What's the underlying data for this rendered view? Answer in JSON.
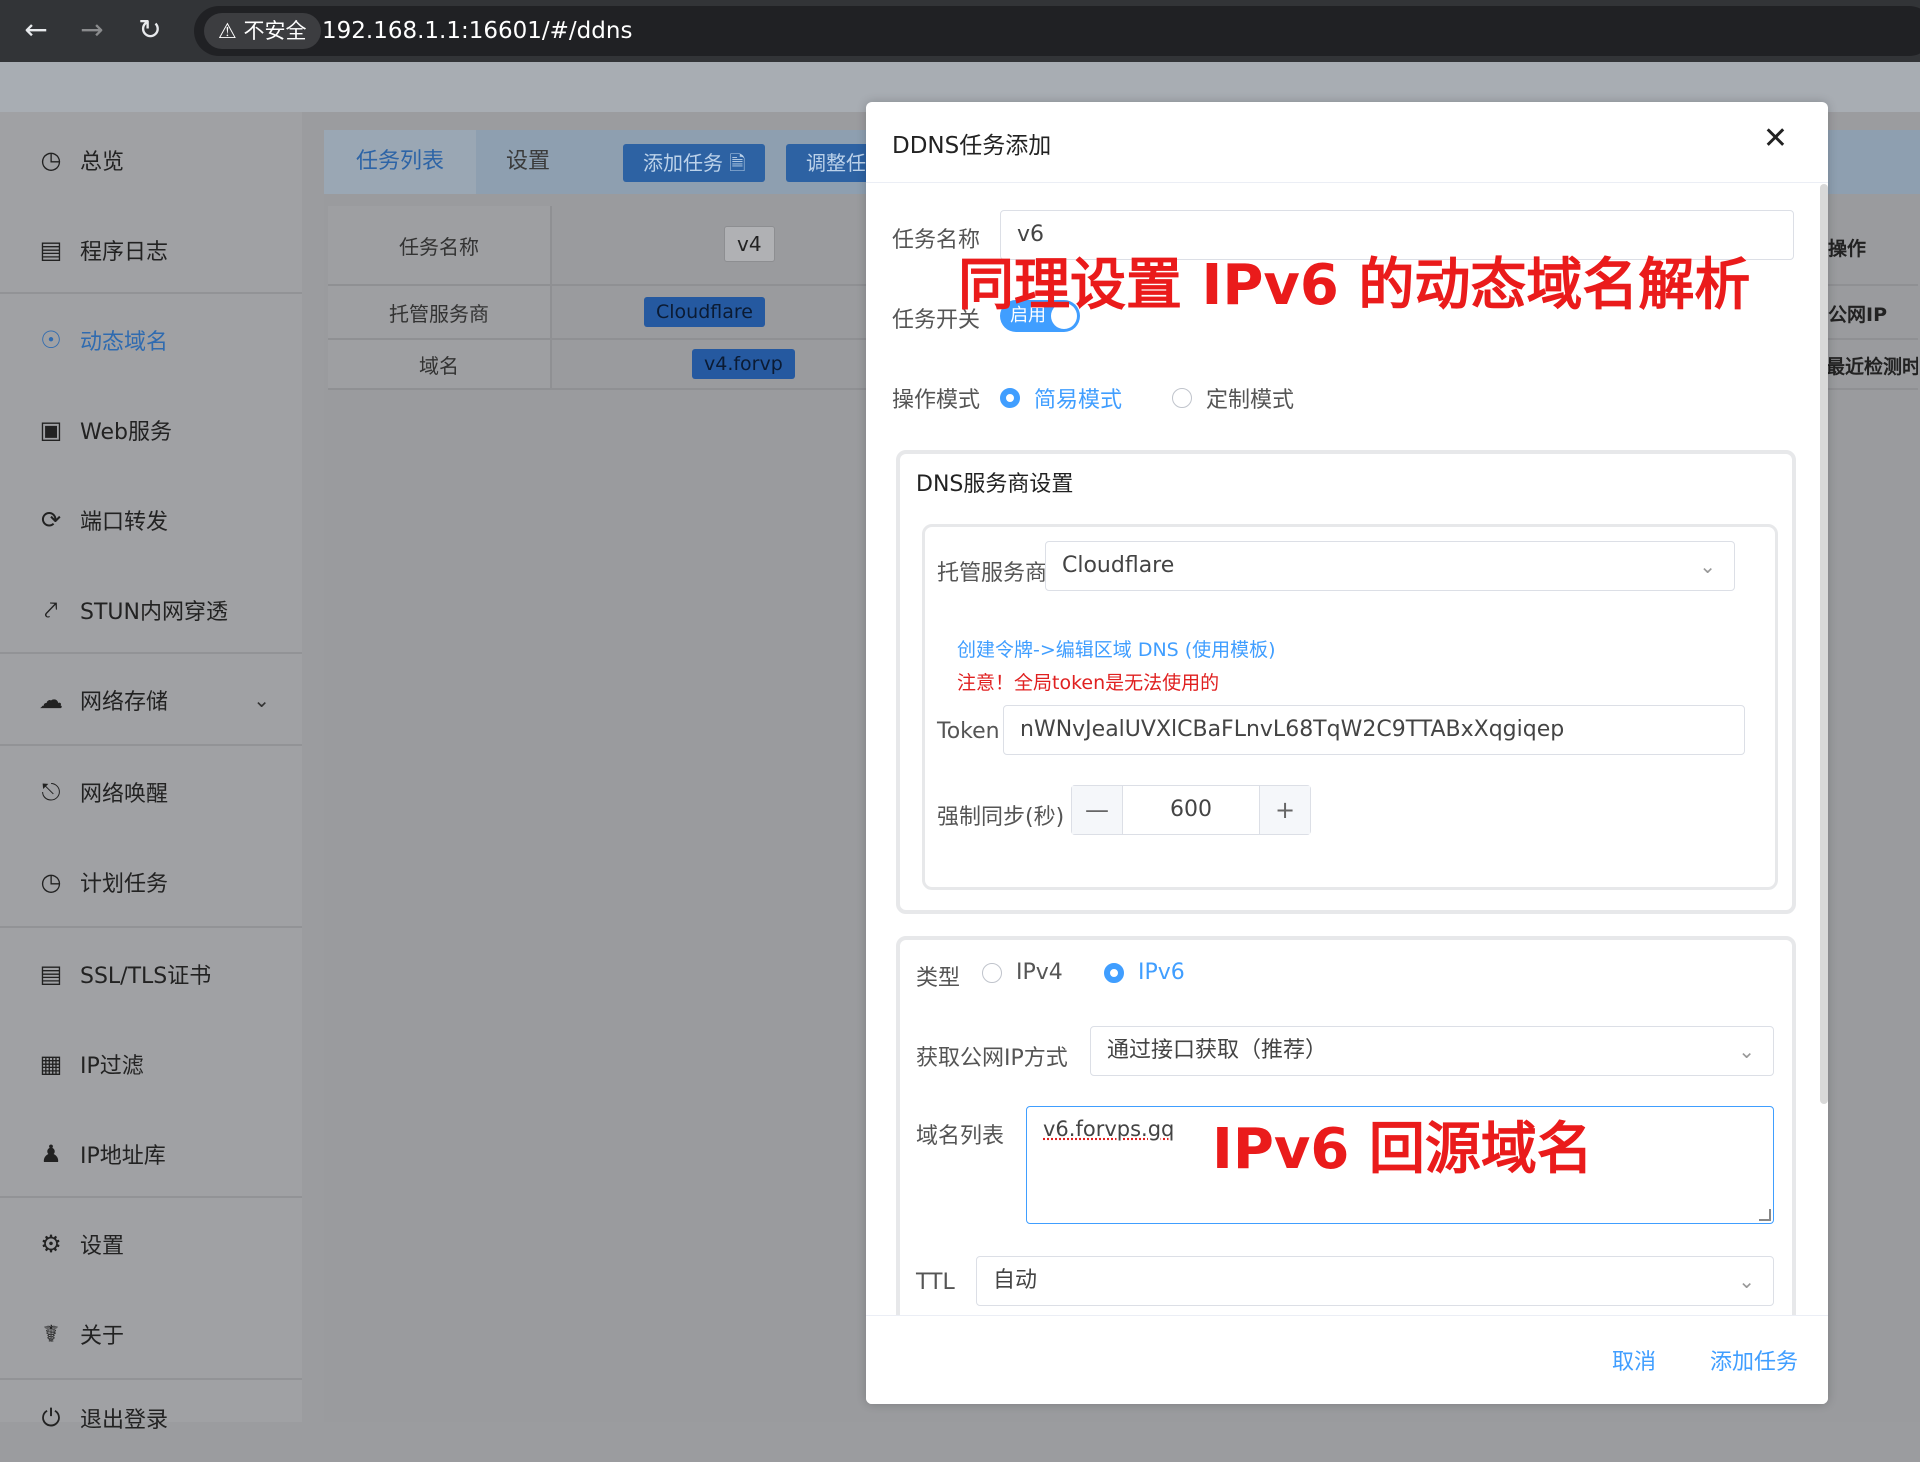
{
  "browser": {
    "insecure_label": "不安全",
    "url": "192.168.1.1:16601/#/ddns",
    "back_icon": "arrow-left-icon",
    "forward_icon": "arrow-right-icon",
    "reload_icon": "reload-icon"
  },
  "sidebar": {
    "items": [
      {
        "label": "总览",
        "icon": "dashboard-icon"
      },
      {
        "label": "程序日志",
        "icon": "log-icon"
      },
      {
        "label": "动态域名",
        "icon": "dns-icon",
        "active": true
      },
      {
        "label": "Web服务",
        "icon": "web-icon"
      },
      {
        "label": "端口转发",
        "icon": "port-forward-icon"
      },
      {
        "label": "STUN内网穿透",
        "icon": "stun-icon"
      },
      {
        "label": "网络存储",
        "icon": "cloud-icon"
      },
      {
        "label": "网络唤醒",
        "icon": "bell-icon"
      },
      {
        "label": "计划任务",
        "icon": "clock-icon"
      },
      {
        "label": "SSL/TLS证书",
        "icon": "certificate-icon"
      },
      {
        "label": "IP过滤",
        "icon": "ip-filter-icon"
      },
      {
        "label": "IP地址库",
        "icon": "user-icon"
      },
      {
        "label": "设置",
        "icon": "gear-icon"
      },
      {
        "label": "关于",
        "icon": "about-icon"
      },
      {
        "label": "退出登录",
        "icon": "logout-icon"
      }
    ],
    "active_color": "#2f6bb0"
  },
  "main": {
    "tabs": [
      "任务列表",
      "设置"
    ],
    "add_task_button": "添加任务 🗎",
    "adjust_button": "调整任",
    "table": {
      "row_headers": [
        "任务名称",
        "托管服务商",
        "域名"
      ],
      "task_tag": "v4",
      "provider_tag": "Cloudflare",
      "domain_tag": "v4.forvp",
      "right_headers": [
        "操作",
        "公网IP",
        "最近检测时"
      ]
    }
  },
  "modal": {
    "title": "DDNS任务添加",
    "close_icon": "close-icon",
    "task_name_label": "任务名称",
    "task_name_value": "v6",
    "switch_label": "任务开关",
    "switch_text": "启用",
    "mode_label": "操作模式",
    "mode_options": [
      "简易模式",
      "定制模式"
    ],
    "mode_selected": "简易模式",
    "dns_card_title": "DNS服务商设置",
    "provider_label": "托管服务商",
    "provider_value": "Cloudflare",
    "token_link": "创建令牌->编辑区域 DNS (使用模板)",
    "token_warning": "注意！全局token是无法使用的",
    "token_label": "Token",
    "token_value": "nWNvJealUVXlCBaFLnvL68TqW2C9TTABxXqgiqep",
    "sync_label": "强制同步(秒)",
    "sync_value": "600",
    "minus": "—",
    "plus": "+",
    "type_label": "类型",
    "type_options": [
      "IPv4",
      "IPv6"
    ],
    "type_selected": "IPv6",
    "ip_method_label": "获取公网IP方式",
    "ip_method_value": "通过接口获取（推荐）",
    "domains_label": "域名列表",
    "domains_value": "v6.forvps.gq",
    "ttl_label": "TTL",
    "ttl_value": "自动",
    "cancel_button": "取消",
    "submit_button": "添加任务",
    "accent_color": "#409eff"
  },
  "annotations": {
    "title_note": "同理设置 IPv6 的动态域名解析",
    "domain_note": "IPv6 回源域名",
    "color": "#ea1b1b"
  }
}
